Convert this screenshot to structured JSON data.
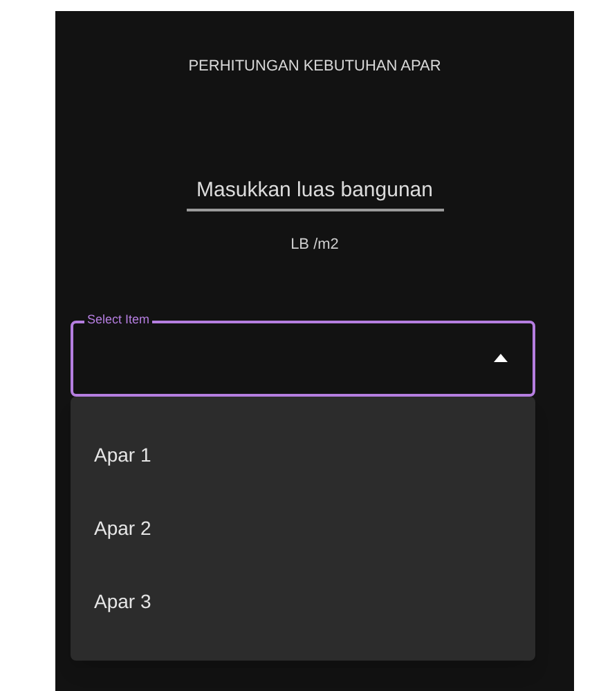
{
  "title": "PERHITUNGAN KEBUTUHAN APAR",
  "area_field": {
    "placeholder": "Masukkan luas bangunan"
  },
  "unit_label": "LB /m2",
  "select": {
    "label": "Select Item",
    "expanded": true
  },
  "options": [
    {
      "label": "Apar 1"
    },
    {
      "label": "Apar 2"
    },
    {
      "label": "Apar 3"
    }
  ]
}
